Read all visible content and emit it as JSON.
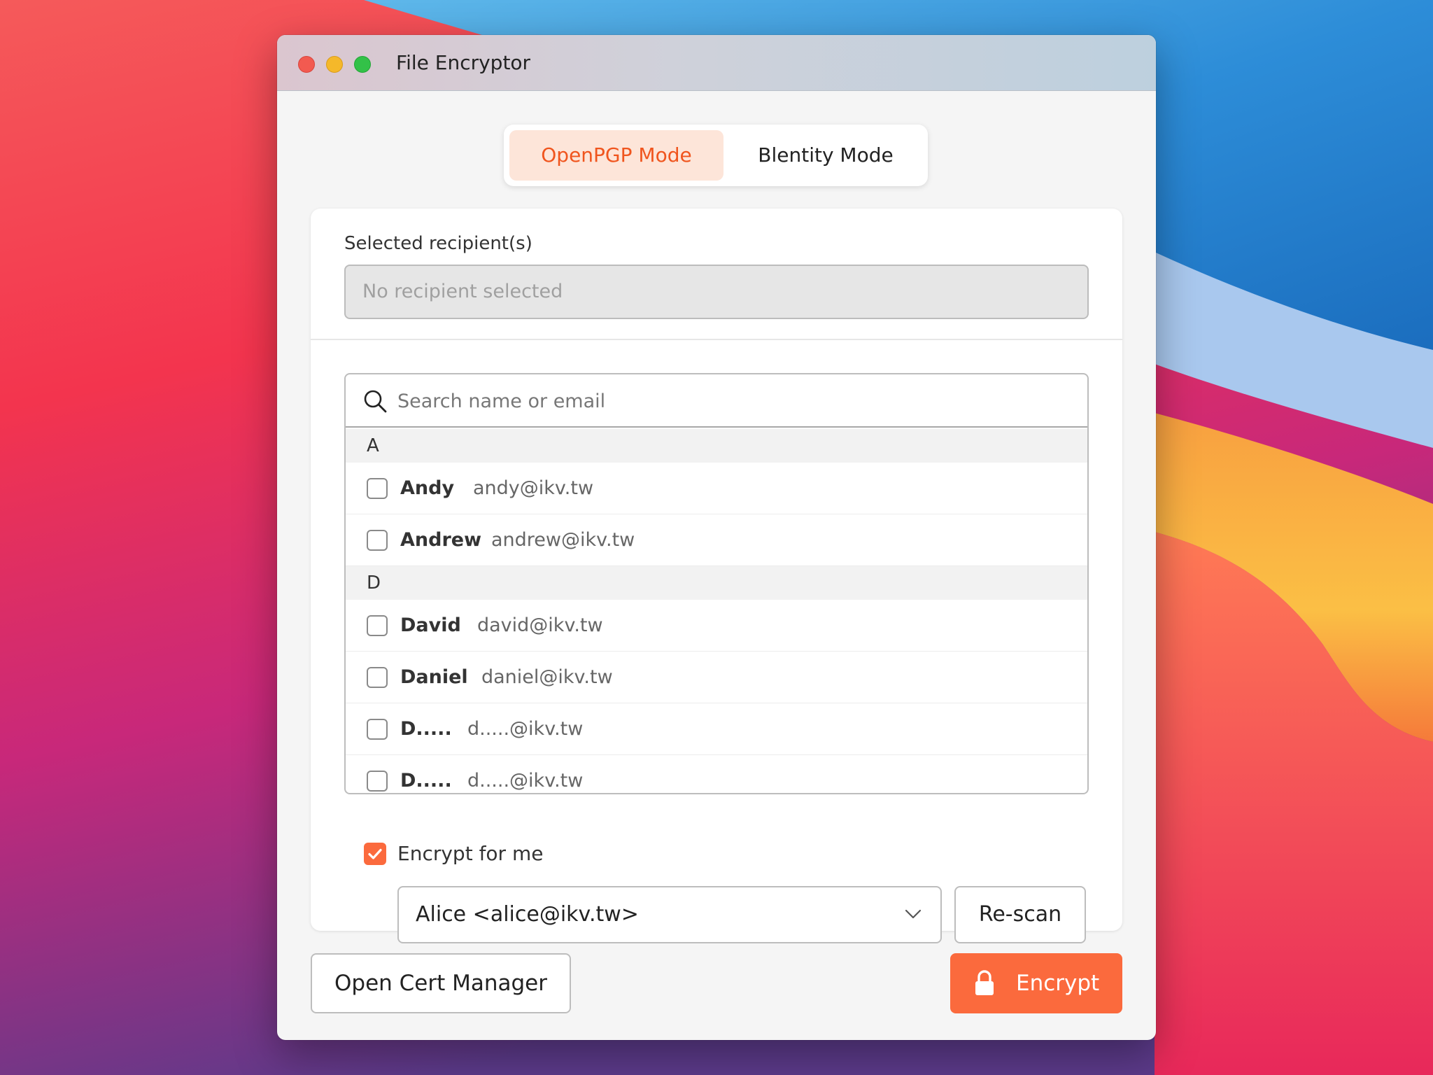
{
  "window": {
    "title": "File Encryptor"
  },
  "modes": {
    "active": "OpenPGP Mode",
    "inactive": "Blentity Mode"
  },
  "recipients": {
    "label": "Selected recipient(s)",
    "placeholder": "No recipient selected"
  },
  "search": {
    "placeholder": "Search name or email"
  },
  "groups": [
    {
      "letter": "A",
      "items": [
        {
          "name": "Andy",
          "email": "andy@ikv.tw"
        },
        {
          "name": "Andrew",
          "email": "andrew@ikv.tw"
        }
      ]
    },
    {
      "letter": "D",
      "items": [
        {
          "name": "David",
          "email": "david@ikv.tw"
        },
        {
          "name": "Daniel",
          "email": "daniel@ikv.tw"
        },
        {
          "name": "D.....",
          "email": "d.....@ikv.tw"
        },
        {
          "name": "D.....",
          "email": "d.....@ikv.tw"
        }
      ]
    }
  ],
  "encrypt_for_me": {
    "label": "Encrypt for me",
    "checked": true
  },
  "identity_select": {
    "value": "Alice <alice@ikv.tw>"
  },
  "buttons": {
    "rescan": "Re-scan",
    "open_cert_manager": "Open Cert Manager",
    "encrypt": "Encrypt"
  },
  "colors": {
    "accent": "#fb6a3d",
    "accent_soft": "#fde5d9",
    "accent_text": "#f0551e"
  },
  "icons": {
    "search": "search-icon",
    "lock": "lock-icon",
    "chevron": "chevron-down-icon",
    "check": "check-icon"
  }
}
